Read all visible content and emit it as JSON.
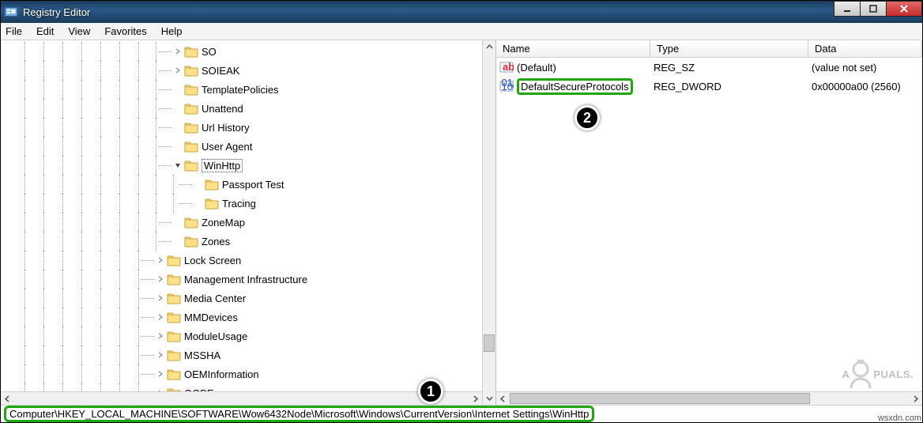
{
  "window": {
    "title": "Registry Editor"
  },
  "menu": {
    "file": "File",
    "edit": "Edit",
    "view": "View",
    "favorites": "Favorites",
    "help": "Help"
  },
  "tree": {
    "items": [
      {
        "indent": 218,
        "arrow": "r",
        "label": "SO"
      },
      {
        "indent": 218,
        "arrow": "r",
        "label": "SOIEAK"
      },
      {
        "indent": 218,
        "arrow": "",
        "label": "TemplatePolicies"
      },
      {
        "indent": 218,
        "arrow": "",
        "label": "Unattend"
      },
      {
        "indent": 218,
        "arrow": "",
        "label": "Url History"
      },
      {
        "indent": 218,
        "arrow": "",
        "label": "User Agent"
      },
      {
        "indent": 218,
        "arrow": "d",
        "label": "WinHttp",
        "selected": true
      },
      {
        "indent": 244,
        "arrow": "",
        "label": "Passport Test"
      },
      {
        "indent": 244,
        "arrow": "",
        "label": "Tracing"
      },
      {
        "indent": 218,
        "arrow": "",
        "label": "ZoneMap"
      },
      {
        "indent": 218,
        "arrow": "",
        "label": "Zones"
      },
      {
        "indent": 196,
        "arrow": "r",
        "label": "Lock Screen"
      },
      {
        "indent": 196,
        "arrow": "r",
        "label": "Management Infrastructure"
      },
      {
        "indent": 196,
        "arrow": "r",
        "label": "Media Center"
      },
      {
        "indent": 196,
        "arrow": "r",
        "label": "MMDevices"
      },
      {
        "indent": 196,
        "arrow": "r",
        "label": "ModuleUsage"
      },
      {
        "indent": 196,
        "arrow": "r",
        "label": "MSSHA"
      },
      {
        "indent": 196,
        "arrow": "r",
        "label": "OEMInformation"
      },
      {
        "indent": 196,
        "arrow": "r",
        "label": "OOBE"
      }
    ],
    "vlines": [
      30,
      54,
      78,
      102,
      126,
      150,
      174,
      196,
      218
    ]
  },
  "columns": {
    "name": "Name",
    "type": "Type",
    "data": "Data"
  },
  "values": [
    {
      "icon": "ab",
      "name": "(Default)",
      "type": "REG_SZ",
      "data": "(value not set)",
      "highlight": false
    },
    {
      "icon": "bin",
      "name": "DefaultSecureProtocols",
      "type": "REG_DWORD",
      "data": "0x00000a00 (2560)",
      "highlight": true
    }
  ],
  "statusPath": "Computer\\HKEY_LOCAL_MACHINE\\SOFTWARE\\Wow6432Node\\Microsoft\\Windows\\CurrentVersion\\Internet Settings\\WinHttp",
  "badges": {
    "one": "1",
    "two": "2"
  },
  "watermark": "A  PUALS",
  "source": "wsxdn.com"
}
